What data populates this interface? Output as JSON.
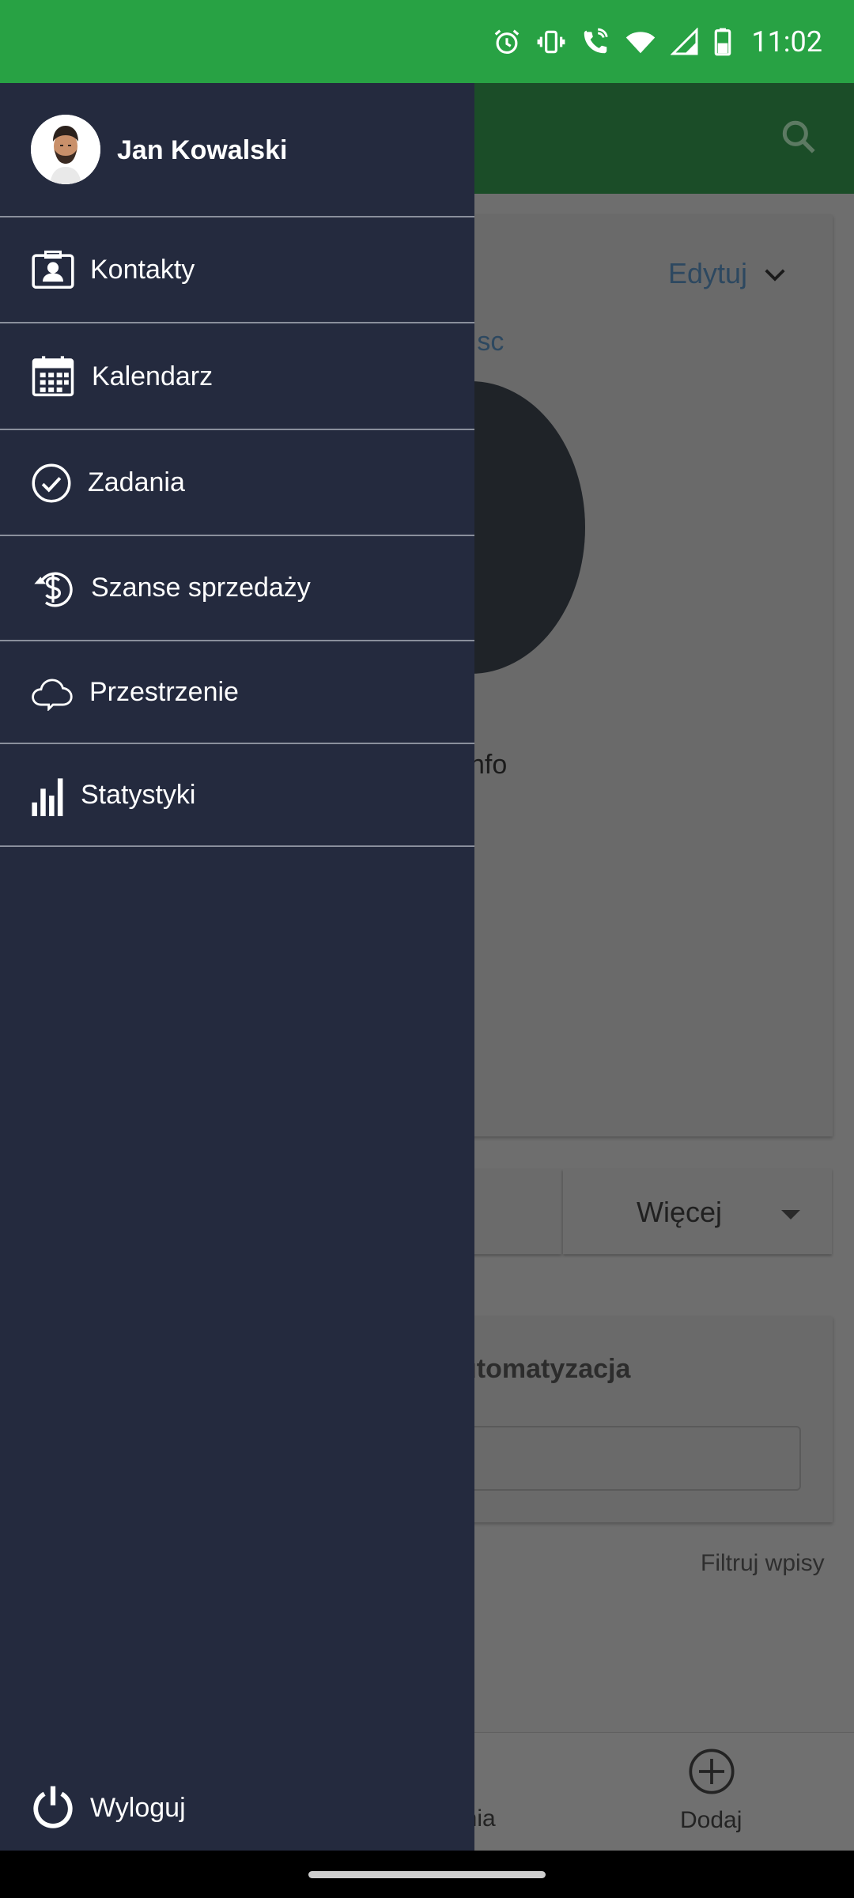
{
  "status_bar": {
    "time": "11:02",
    "icons": [
      "alarm-icon",
      "vibrate-icon",
      "wifi-calling-icon",
      "wifi-icon",
      "signal-icon",
      "battery-icon"
    ],
    "background": "#28a244"
  },
  "drawer": {
    "user_name": "Jan Kowalski",
    "items": [
      {
        "label": "Kontakty",
        "icon": "contact-card-icon"
      },
      {
        "label": "Kalendarz",
        "icon": "calendar-icon"
      },
      {
        "label": "Zadania",
        "icon": "check-circle-icon"
      },
      {
        "label": "Szanse sprzedaży",
        "icon": "dollar-refresh-icon"
      },
      {
        "label": "Przestrzenie",
        "icon": "cloud-icon"
      },
      {
        "label": "Statystyki",
        "icon": "bar-chart-icon"
      }
    ],
    "logout_label": "Wyloguj",
    "background": "#242a3e"
  },
  "background_app": {
    "edit_label": "Edytuj",
    "company_fragment": "n sc",
    "info_fragment": "nfo",
    "more_label": "Więcej",
    "automation_fragment": "utomatyzacja",
    "filter_label": "Filtruj wpisy",
    "bottom_nav_fragment": "enia",
    "add_label": "Dodaj"
  }
}
